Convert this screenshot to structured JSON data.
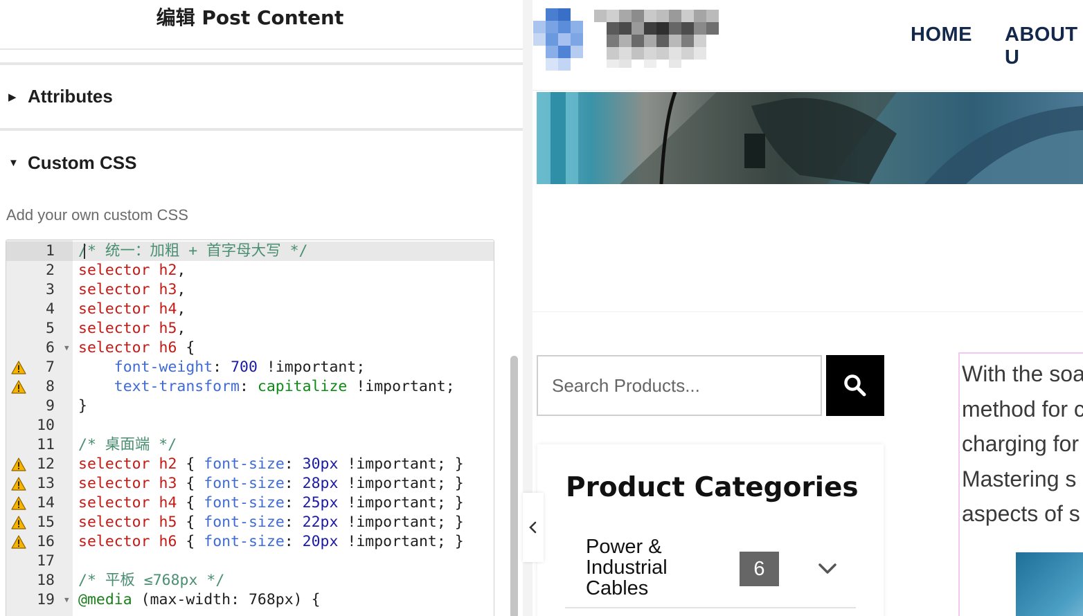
{
  "panel": {
    "title": "编辑 Post Content",
    "sections": {
      "attributes_label": "Attributes",
      "custom_css_label": "Custom CSS"
    },
    "custom_css_help": "Add your own custom CSS",
    "code_lines": [
      {
        "n": "1",
        "warn": false,
        "fold": false
      },
      {
        "n": "2",
        "warn": false,
        "fold": false
      },
      {
        "n": "3",
        "warn": false,
        "fold": false
      },
      {
        "n": "4",
        "warn": false,
        "fold": false
      },
      {
        "n": "5",
        "warn": false,
        "fold": false
      },
      {
        "n": "6",
        "warn": false,
        "fold": true
      },
      {
        "n": "7",
        "warn": true,
        "fold": false
      },
      {
        "n": "8",
        "warn": true,
        "fold": false
      },
      {
        "n": "9",
        "warn": false,
        "fold": false
      },
      {
        "n": "10",
        "warn": false,
        "fold": false
      },
      {
        "n": "11",
        "warn": false,
        "fold": false
      },
      {
        "n": "12",
        "warn": true,
        "fold": false
      },
      {
        "n": "13",
        "warn": true,
        "fold": false
      },
      {
        "n": "14",
        "warn": true,
        "fold": false
      },
      {
        "n": "15",
        "warn": true,
        "fold": false
      },
      {
        "n": "16",
        "warn": true,
        "fold": false
      },
      {
        "n": "17",
        "warn": false,
        "fold": false
      },
      {
        "n": "18",
        "warn": false,
        "fold": false
      },
      {
        "n": "19",
        "warn": false,
        "fold": true
      }
    ],
    "code_text": {
      "l1": "/* 统一：加粗 + 首字母大写 */",
      "sel": "selector",
      "h2": "h2",
      "h3": "h3",
      "h4": "h4",
      "h5": "h5",
      "h6": "h6",
      "comma": ",",
      "open_brace": "{",
      "close_brace": "}",
      "font_weight": "font-weight",
      "w700": "700",
      "important_semi": "!important;",
      "text_transform": "text-transform",
      "capitalize": "capitalize",
      "l11": "/* 桌面端 */",
      "font_size": "font-size",
      "s30": "30px",
      "s28": "28px",
      "s25": "25px",
      "s22": "22px",
      "s20": "20px",
      "l18": "/* 平板 ≤768px */",
      "media": "@media",
      "media_rest": "(max-width: 768px) {",
      "colon": ":"
    }
  },
  "site": {
    "nav": [
      "HOME",
      "ABOUT U"
    ],
    "search_placeholder": "Search Products...",
    "categories": {
      "title": "Product Categories",
      "item_name": "Power & Industrial Cables",
      "item_count": "6"
    },
    "intro_lines": [
      "With the soa",
      "method for c",
      "charging for",
      "Mastering s",
      "aspects of s"
    ]
  },
  "colors": {
    "nav_text": "#14284b",
    "code_selector": "#c41a16",
    "code_property": "#3f6bd8",
    "code_number": "#1a1aa6",
    "code_keyword": "#0e8a16",
    "code_comment": "#4a8f71",
    "search_button": "#000000",
    "count_badge": "#666666",
    "intro_border": "#f0c8f0"
  },
  "icons": {
    "warning": "warning-icon",
    "fold": "fold-arrow-icon",
    "search": "search-icon",
    "chevron_down": "chevron-down-icon",
    "chevron_left": "chevron-left-icon",
    "caret_right": "caret-right-icon",
    "caret_down": "caret-down-icon"
  }
}
